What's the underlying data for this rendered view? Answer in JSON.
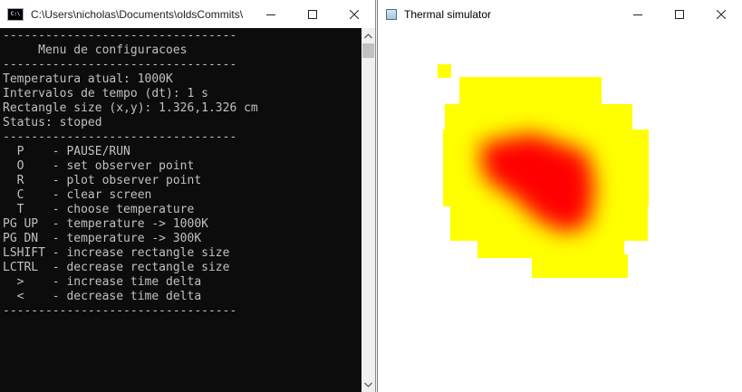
{
  "console": {
    "title": "C:\\Users\\nicholas\\Documents\\oldsCommits\\",
    "app_icon": "C:\\",
    "lines": [
      "---------------------------------",
      "     Menu de configuracoes",
      "---------------------------------",
      "Temperatura atual: 1000K",
      "Intervalos de tempo (dt): 1 s",
      "Rectangle size (x,y): 1.326,1.326 cm",
      "Status: stoped",
      "---------------------------------",
      "  P    - PAUSE/RUN",
      "  O    - set observer point",
      "  R    - plot observer point",
      "  C    - clear screen",
      "  T    - choose temperature",
      "PG UP  - temperature -> 1000K",
      "PG DN  - temperature -> 300K",
      "LSHIFT - increase rectangle size",
      "LCTRL  - decrease rectangle size",
      "  >    - increase time delta",
      "  <    - decrease time delta",
      "---------------------------------"
    ]
  },
  "simulator": {
    "title": "Thermal simulator"
  },
  "colors": {
    "console_bg": "#0c0c0c",
    "console_text": "#c0c0c0",
    "heat_low": "#ffff00",
    "heat_high": "#ff0000"
  },
  "icons": {
    "console_controls": [
      "minimize-icon",
      "maximize-icon",
      "close-icon"
    ],
    "sim_controls": [
      "minimize-icon",
      "maximize-icon",
      "close-icon"
    ]
  }
}
